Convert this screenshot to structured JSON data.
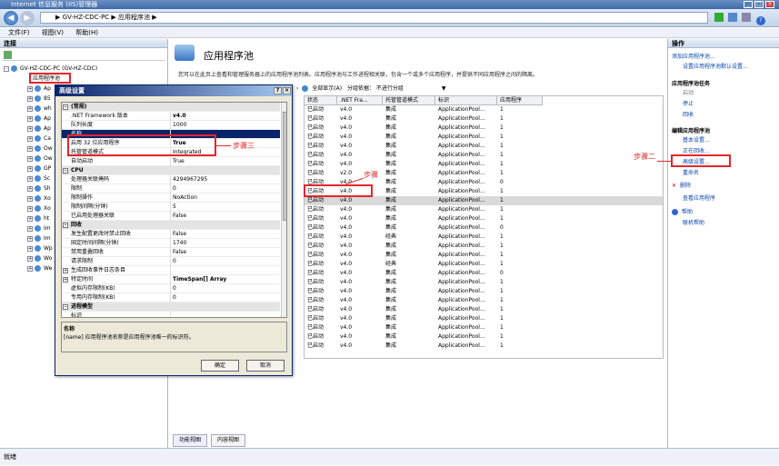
{
  "window": {
    "title": "Internet 信息服务 (IIS)管理器"
  },
  "address": {
    "path": "▶ GV-HZ-CDC-PC ▶ 应用程序池 ▶"
  },
  "menu": [
    "文件(F)",
    "视图(V)",
    "帮助(H)"
  ],
  "left_pane": {
    "header": "连接",
    "server_node": "GV-HZ-CDC-PC (GV-HZ-CDC)",
    "app_pools_node": "应用程序池",
    "site_stubs": [
      "Ap",
      "85",
      "wh",
      "Ap",
      "Ap",
      "Ca",
      "Ow",
      "Ow",
      "GP",
      "Sc",
      "Sh",
      "Xo",
      "Xo",
      "ht",
      "Im",
      "Im",
      "Wp",
      "Wo",
      "We"
    ]
  },
  "center": {
    "title": "应用程序池",
    "description": "您可以在此页上查看和管理服务器上的应用程序池列表。应用程序池与工作进程相关联，包含一个或多个应用程序，并提供不同应用程序之间的隔离。",
    "toolbar_filter": "全部显示(A)",
    "toolbar_group": "分组依据：",
    "toolbar_group_value": "不进行分组",
    "columns": [
      "状态",
      ".NET Fra...",
      "托管管道模式",
      "标识",
      "应用程序"
    ],
    "rows": [
      [
        "已启动",
        "v4.0",
        "集成",
        "ApplicationPool...",
        "1"
      ],
      [
        "已启动",
        "v4.0",
        "集成",
        "ApplicationPool...",
        "1"
      ],
      [
        "已启动",
        "v4.0",
        "集成",
        "ApplicationPool...",
        "1"
      ],
      [
        "已启动",
        "v4.0",
        "集成",
        "ApplicationPool...",
        "1"
      ],
      [
        "已启动",
        "v4.0",
        "集成",
        "ApplicationPool...",
        "1"
      ],
      [
        "已启动",
        "v4.0",
        "集成",
        "ApplicationPool...",
        "1"
      ],
      [
        "已启动",
        "v4.0",
        "集成",
        "ApplicationPool...",
        "1"
      ],
      [
        "已启动",
        "v2.0",
        "集成",
        "ApplicationPool...",
        "1"
      ],
      [
        "已启动",
        "v4.0",
        "集成",
        "ApplicationPool...",
        "0"
      ],
      [
        "已启动",
        "v4.0",
        "集成",
        "ApplicationPool...",
        "1"
      ],
      [
        "已启动",
        "v4.0",
        "集成",
        "ApplicationPool...",
        "1"
      ],
      [
        "已启动",
        "v4.0",
        "集成",
        "ApplicationPool...",
        "1"
      ],
      [
        "已启动",
        "v4.0",
        "集成",
        "ApplicationPool...",
        "1"
      ],
      [
        "已启动",
        "v4.0",
        "集成",
        "ApplicationPool...",
        "0"
      ],
      [
        "已启动",
        "v4.0",
        "经典",
        "ApplicationPool...",
        "1"
      ],
      [
        "已启动",
        "v4.0",
        "集成",
        "ApplicationPool...",
        "1"
      ],
      [
        "已启动",
        "v4.0",
        "集成",
        "ApplicationPool...",
        "1"
      ],
      [
        "已启动",
        "v4.0",
        "经典",
        "ApplicationPool...",
        "1"
      ],
      [
        "已启动",
        "v4.0",
        "集成",
        "ApplicationPool...",
        "0"
      ],
      [
        "已启动",
        "v4.0",
        "集成",
        "ApplicationPool...",
        "1"
      ],
      [
        "已启动",
        "v4.0",
        "集成",
        "ApplicationPool...",
        "1"
      ],
      [
        "已启动",
        "v4.0",
        "集成",
        "ApplicationPool...",
        "1"
      ],
      [
        "已启动",
        "v4.0",
        "集成",
        "ApplicationPool...",
        "1"
      ],
      [
        "已启动",
        "v4.0",
        "集成",
        "ApplicationPool...",
        "1"
      ],
      [
        "已启动",
        "v4.0",
        "集成",
        "ApplicationPool...",
        "1"
      ],
      [
        "已启动",
        "v4.0",
        "集成",
        "ApplicationPool...",
        "1"
      ],
      [
        "已启动",
        "v4.0",
        "集成",
        "ApplicationPool...",
        "1"
      ]
    ],
    "view_tabs": [
      "功能视图",
      "内容视图"
    ]
  },
  "right_pane": {
    "header": "操作",
    "add_pool": "添加应用程序池...",
    "set_defaults": "设置应用程序池默认设置...",
    "tasks_header": "应用程序池任务",
    "start": "启动",
    "stop": "停止",
    "recycle": "回收",
    "edit_header": "编辑应用程序池",
    "basic_settings": "基本设置...",
    "recycling": "正在回收...",
    "advanced_settings": "高级设置...",
    "rename": "重命名",
    "remove": "删除",
    "view_apps": "查看应用程序",
    "help": "帮助",
    "online_help": "联机帮助"
  },
  "status_bar": {
    "text": "就绪"
  },
  "dialog": {
    "title": "高级设置",
    "rows": [
      {
        "cat": true,
        "k": "(常规)",
        "v": ""
      },
      {
        "k": ".NET Framework 版本",
        "v": "v4.0",
        "bold": true
      },
      {
        "k": "队列长度",
        "v": "1000"
      },
      {
        "k": "名称",
        "v": "",
        "sel": true
      },
      {
        "k": "启用 32 位应用程序",
        "v": "True",
        "bold": true
      },
      {
        "k": "托管管道模式",
        "v": "Integrated"
      },
      {
        "k": "自动启动",
        "v": "True"
      },
      {
        "cat": true,
        "k": "CPU",
        "v": ""
      },
      {
        "k": "处理器关联掩码",
        "v": "4294967295"
      },
      {
        "k": "限制",
        "v": "0"
      },
      {
        "k": "限制操作",
        "v": "NoAction"
      },
      {
        "k": "限制间隔(分钟)",
        "v": "5"
      },
      {
        "k": "已启用处理器关联",
        "v": "False"
      },
      {
        "cat": true,
        "k": "回收",
        "v": ""
      },
      {
        "k": "发生配置更改时禁止回收",
        "v": "False"
      },
      {
        "k": "固定时间间隔(分钟)",
        "v": "1740"
      },
      {
        "k": "禁用重叠回收",
        "v": "False"
      },
      {
        "k": "请求限制",
        "v": "0"
      },
      {
        "k": "生成回收事件日志条目",
        "v": "",
        "exp": true
      },
      {
        "k": "特定时间",
        "v": "TimeSpan[] Array",
        "bold": true,
        "exp": true
      },
      {
        "k": "虚拟内存限制(KB)",
        "v": "0"
      },
      {
        "k": "专用内存限制(KB)",
        "v": "0"
      },
      {
        "cat": true,
        "k": "进程模型",
        "v": ""
      },
      {
        "k": "标识",
        "v": ""
      }
    ],
    "desc_title": "名称",
    "desc_text": "[name] 应用程序池名称是应用程序池唯一的标识符。",
    "ok": "确定",
    "cancel": "取消"
  },
  "annotations": {
    "step2": "步骤二",
    "step3": "步骤三",
    "step4": "步骤"
  },
  "colors": {
    "accent": "#e5262a",
    "selection": "#0a246a"
  }
}
